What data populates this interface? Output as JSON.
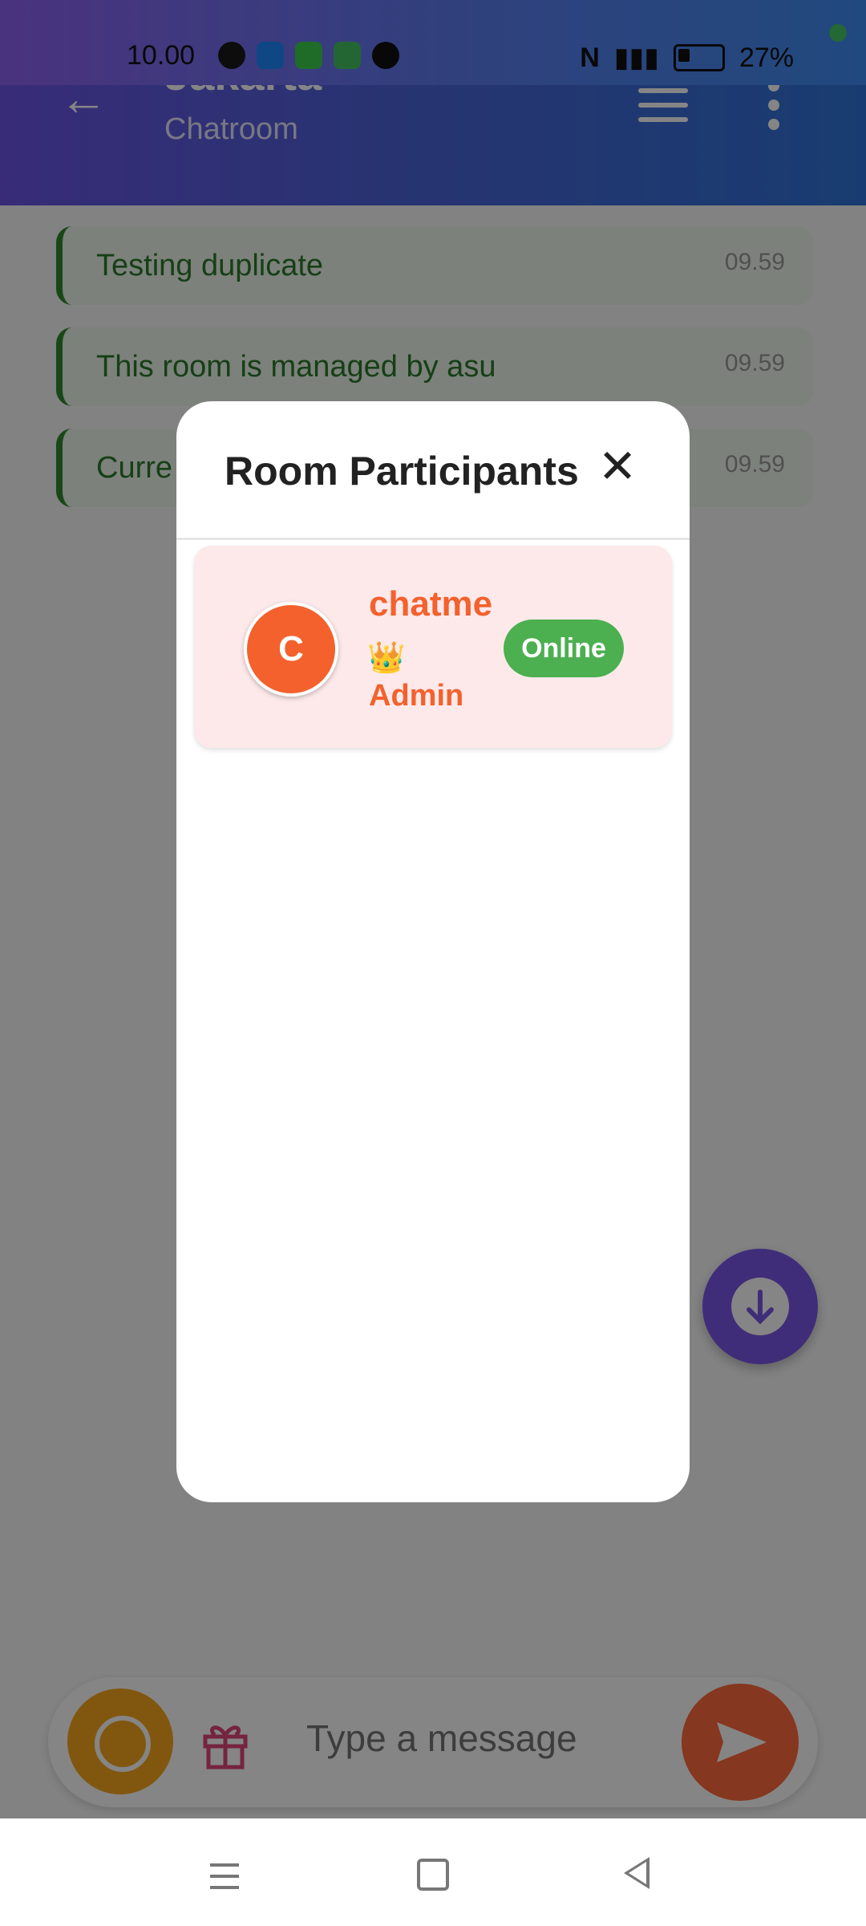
{
  "status_bar": {
    "time": "10.00",
    "battery": "27%",
    "icons": [
      "whatsapp-icon",
      "message-icon",
      "app-icon",
      "chat-icon",
      "tiktok-icon"
    ]
  },
  "header": {
    "title": "Jakarta",
    "subtitle": "Chatroom"
  },
  "messages": [
    {
      "text": "Testing duplicate",
      "time": "09.59"
    },
    {
      "text": "This room is managed by asu",
      "time": "09.59"
    },
    {
      "text": "Curre",
      "time": "09.59"
    }
  ],
  "composer": {
    "placeholder": "Type a message"
  },
  "modal": {
    "title": "Room Participants",
    "close_glyph": "✕",
    "participants": [
      {
        "initial": "C",
        "name": "chatme",
        "badge_icon": "👑",
        "role": "Admin",
        "status": "Online"
      }
    ]
  },
  "colors": {
    "header_gradient_start": "#6b54e6",
    "header_gradient_end": "#2f74d8",
    "message_text": "#2b7a2b",
    "participant_accent": "#f4612c",
    "online_badge": "#4caf50",
    "fab": "#7b57e8",
    "send_button": "#ff6a3d",
    "emoji_button": "#f7a820"
  }
}
